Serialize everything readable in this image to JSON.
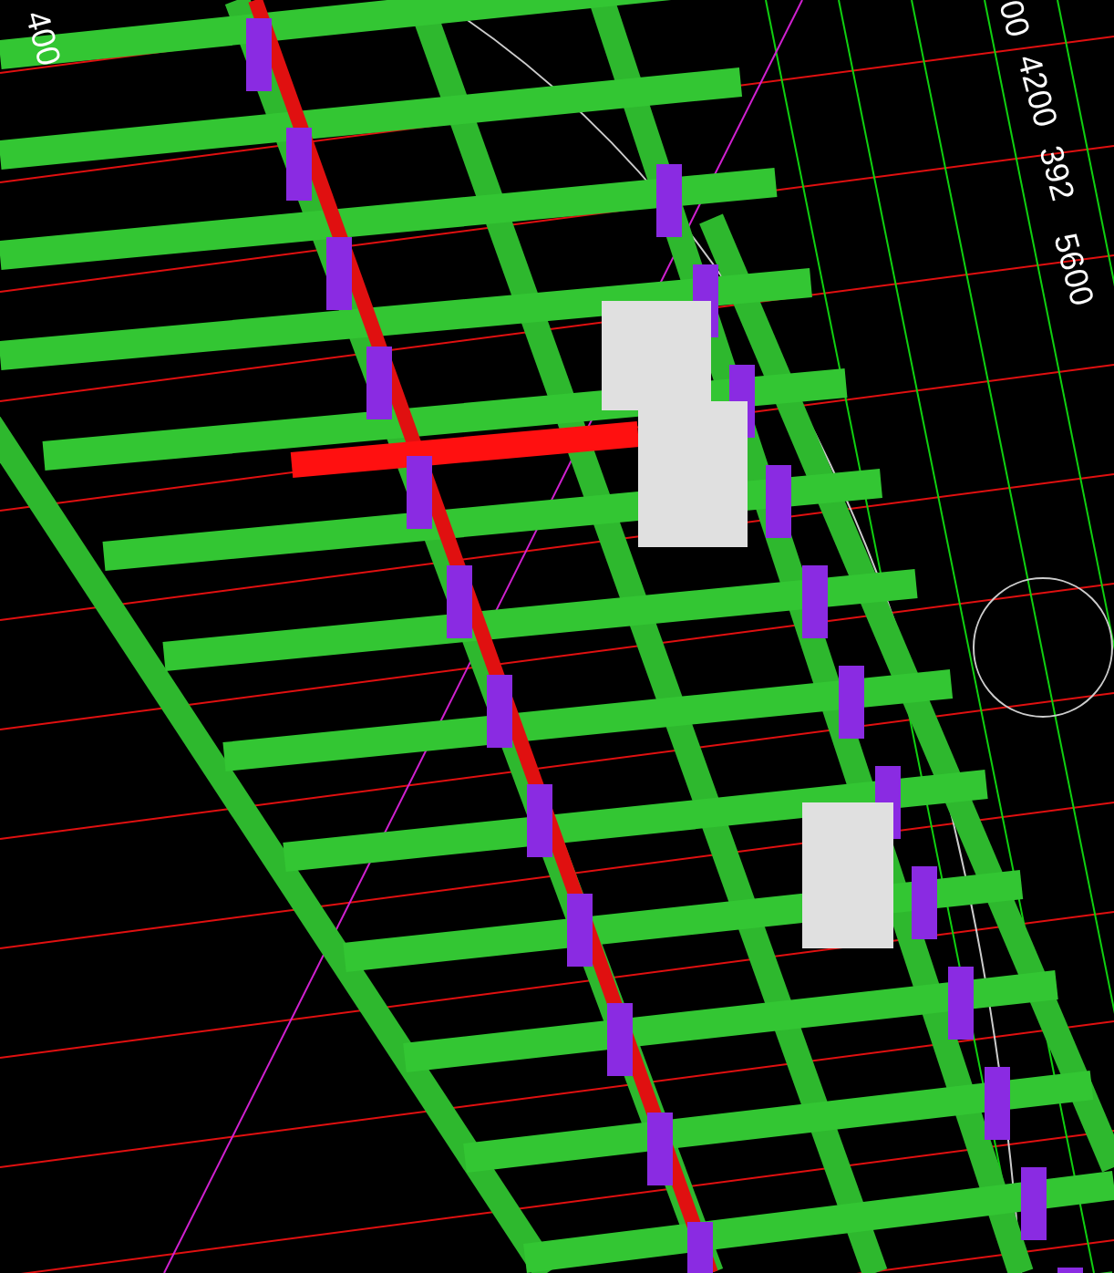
{
  "viewport": {
    "dimension_labels": [
      "400",
      "00",
      "4200",
      "392",
      "5600"
    ]
  }
}
